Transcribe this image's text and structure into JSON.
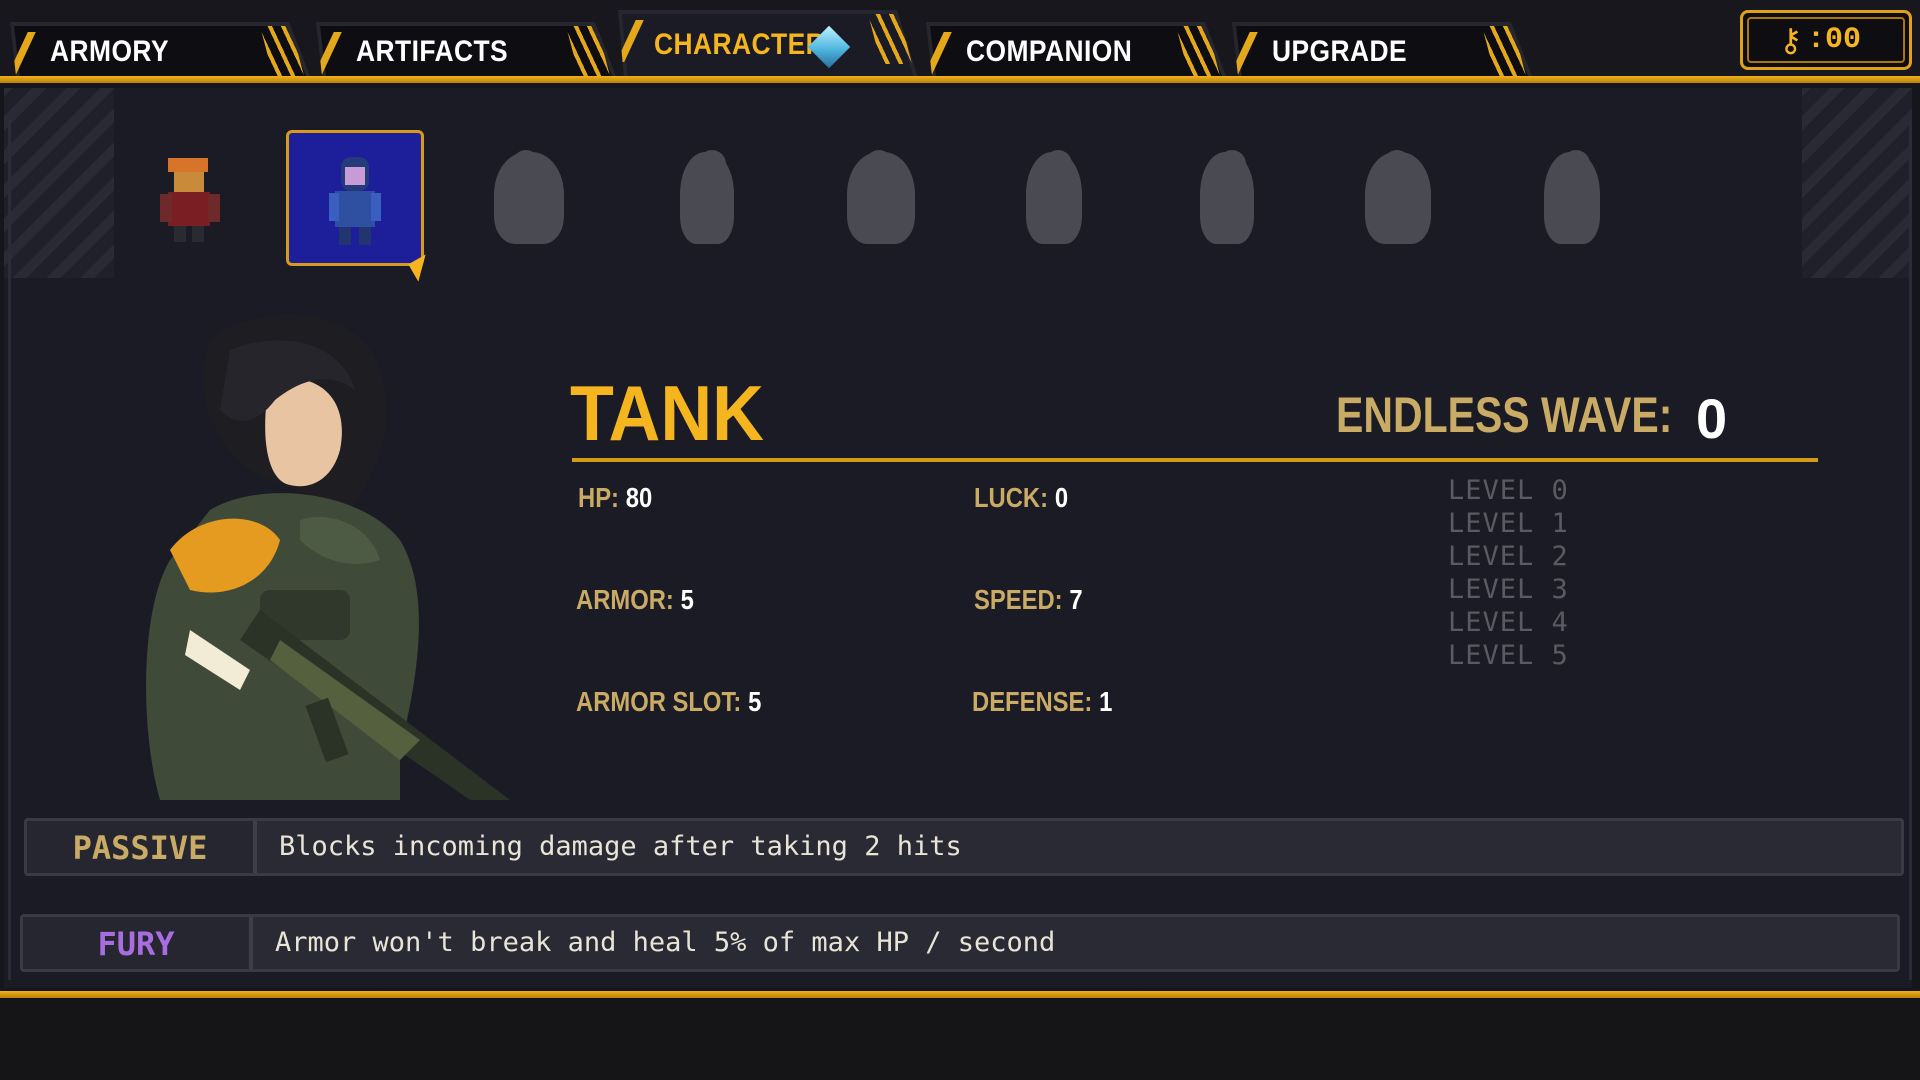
{
  "nav": {
    "tabs": [
      {
        "label": "ARMORY",
        "active": false
      },
      {
        "label": "ARTIFACTS",
        "active": false
      },
      {
        "label": "CHARACTER",
        "active": true
      },
      {
        "label": "COMPANION",
        "active": false
      },
      {
        "label": "UPGRADE",
        "active": false
      }
    ],
    "keys": {
      "icon": "key-icon",
      "count": ":00"
    }
  },
  "roster": {
    "selected_index": 1,
    "slots": [
      "unlocked",
      "selected",
      "locked",
      "locked",
      "locked",
      "locked",
      "locked",
      "locked",
      "locked"
    ]
  },
  "character": {
    "name": "TANK",
    "endless_wave_label": "ENDLESS WAVE:",
    "endless_wave_value": "0",
    "stats": [
      {
        "label": "HP:",
        "value": "80"
      },
      {
        "label": "LUCK:",
        "value": "0"
      },
      {
        "label": "ARMOR:",
        "value": "5"
      },
      {
        "label": "SPEED:",
        "value": "7"
      },
      {
        "label": "ARMOR SLOT:",
        "value": "5"
      },
      {
        "label": "DEFENSE:",
        "value": "1"
      }
    ],
    "levels": [
      "LEVEL 0",
      "LEVEL 1",
      "LEVEL 2",
      "LEVEL 3",
      "LEVEL 4",
      "LEVEL 5"
    ]
  },
  "abilities": {
    "passive": {
      "label": "PASSIVE",
      "text": "Blocks incoming damage after taking 2 hits",
      "color": "#c9ab66"
    },
    "fury": {
      "label": "FURY",
      "text": "Armor won't break and heal 5% of max HP / second",
      "color": "#a86ee0"
    }
  },
  "colors": {
    "accent": "#f4b51f",
    "stat_label": "#c9ab66",
    "selected_bg": "#1c1e9a"
  }
}
